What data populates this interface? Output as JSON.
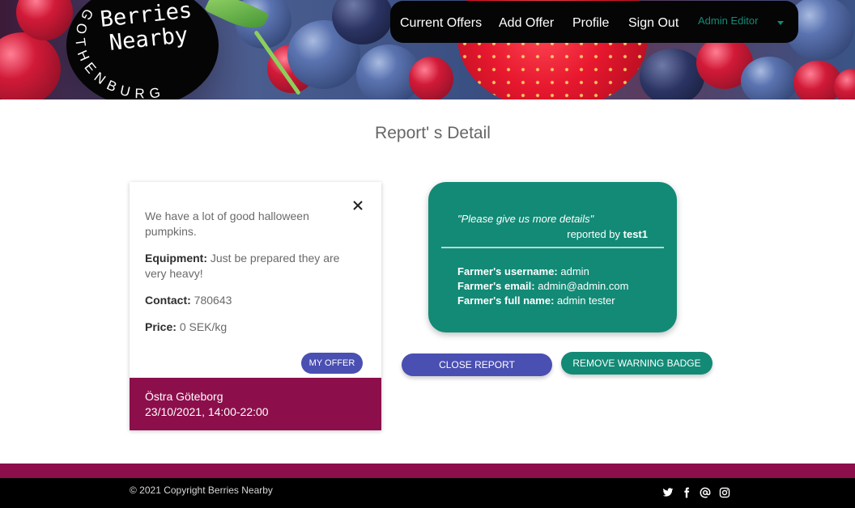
{
  "brand": {
    "name_line1": "Berries",
    "name_line2": "Nearby",
    "ring_text": "GOTHENBURG"
  },
  "nav": {
    "items": [
      {
        "label": "Current Offers"
      },
      {
        "label": "Add Offer"
      },
      {
        "label": "Profile"
      },
      {
        "label": "Sign Out"
      }
    ],
    "admin_label": "Admin Editor"
  },
  "page": {
    "title": "Report' s Detail"
  },
  "offer": {
    "description": "We have a lot of good halloween pumpkins.",
    "equipment_label": "Equipment:",
    "equipment": "Just be prepared they are very heavy!",
    "contact_label": "Contact:",
    "contact": "780643",
    "price_label": "Price:",
    "price": "0 SEK/kg",
    "my_offer_button": "MY OFFER",
    "location": "Östra Göteborg",
    "datetime": "23/10/2021, 14:00-22:00"
  },
  "report": {
    "quote": "\"Please give us more details\"",
    "reported_by_label": "reported by",
    "reporter": "test1",
    "username_label": "Farmer's username:",
    "username": "admin",
    "email_label": "Farmer's email:",
    "email": "admin@admin.com",
    "fullname_label": "Farmer's full name:",
    "fullname": "admin tester"
  },
  "actions": {
    "close_report": "CLOSE REPORT",
    "remove_badge": "REMOVE WARNING BADGE"
  },
  "footer": {
    "copyright": "© 2021 Copyright Berries Nearby",
    "social_icons": [
      "twitter-icon",
      "facebook-icon",
      "email-icon",
      "instagram-icon"
    ]
  },
  "colors": {
    "accent_teal": "#128a76",
    "accent_indigo": "#4a4fb2",
    "accent_magenta": "#8c0f4c"
  }
}
